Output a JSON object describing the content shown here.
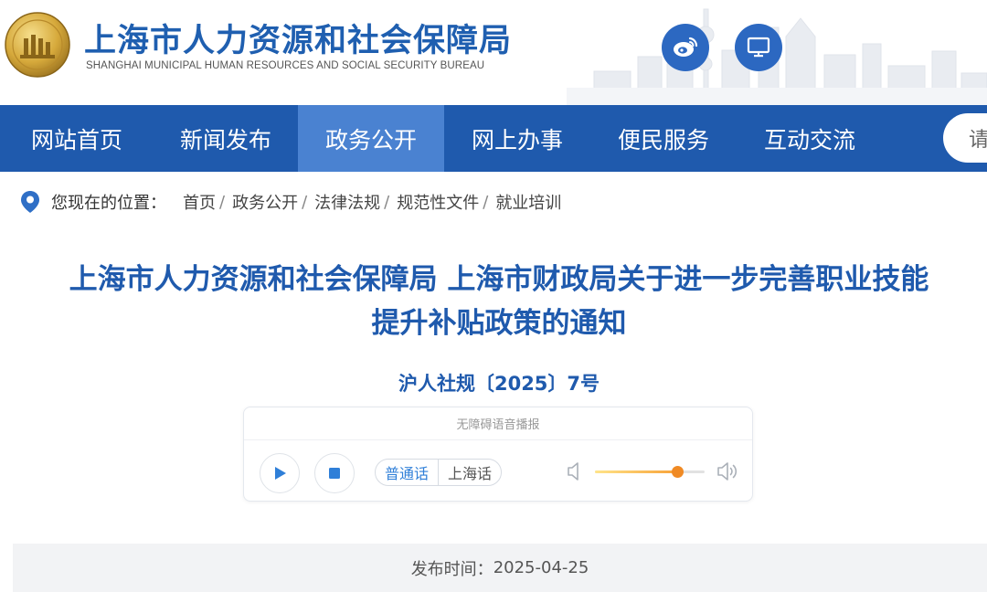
{
  "header": {
    "title": "上海市人力资源和社会保障局",
    "subtitle": "SHANGHAI MUNICIPAL HUMAN RESOURCES AND SOCIAL SECURITY BUREAU",
    "icons": [
      "weibo-icon",
      "screen-icon"
    ]
  },
  "nav": {
    "items": [
      "网站首页",
      "新闻发布",
      "政务公开",
      "网上办事",
      "便民服务",
      "互动交流"
    ],
    "active_index": 2,
    "search_placeholder": "请"
  },
  "breadcrumb": {
    "label": "您现在的位置：",
    "items": [
      "首页",
      "政务公开",
      "法律法规",
      "规范性文件",
      "就业培训"
    ],
    "separator": "/"
  },
  "article": {
    "title_line1": "上海市人力资源和社会保障局 上海市财政局关于进一步完善职业技能",
    "title_line2": "提升补贴政策的通知",
    "doc_number": "沪人社规〔2025〕7号"
  },
  "player": {
    "header": "无障碍语音播报",
    "dialect_selected": "普通话",
    "dialect_other": "上海话",
    "volume": 0.75
  },
  "publish": {
    "label": "发布时间：",
    "date": "2025-04-25"
  },
  "colors": {
    "brand_blue": "#1f5aad",
    "nav_active": "#4a82d1",
    "title_blue": "#1f5aad",
    "volume_orange": "#f08a24"
  }
}
